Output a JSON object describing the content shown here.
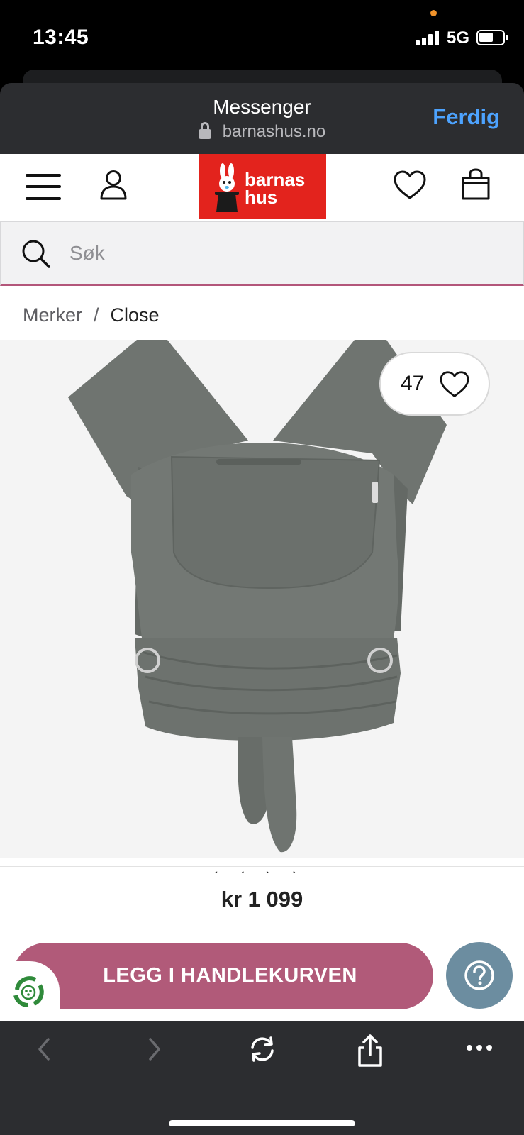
{
  "status_bar": {
    "time": "13:45",
    "network": "5G",
    "battery_level": 0.6
  },
  "browser_sheet": {
    "title": "Messenger",
    "url": "barnashus.no",
    "done_label": "Ferdig"
  },
  "header": {
    "logo_line1": "barnas",
    "logo_line2": "hus",
    "logo_color": "#e3231d",
    "icons": [
      "menu-icon",
      "account-icon",
      "heart-icon",
      "shopping-bag-icon"
    ]
  },
  "search": {
    "placeholder": "Søk"
  },
  "breadcrumb": {
    "items": [
      "Merker",
      "Close"
    ],
    "separator": "/"
  },
  "product": {
    "favorite_count": "47",
    "price": "kr 1 099",
    "image_subject": "grey baby carrier wrap"
  },
  "actions": {
    "add_to_cart": "LEGG I HANDLEKURVEN",
    "add_to_cart_color": "#b15a79",
    "help_icon": "question-icon",
    "help_color": "#6c8da0"
  },
  "toolbar": {
    "items": [
      "back-icon",
      "forward-icon",
      "reload-icon",
      "share-icon",
      "more-icon"
    ]
  }
}
